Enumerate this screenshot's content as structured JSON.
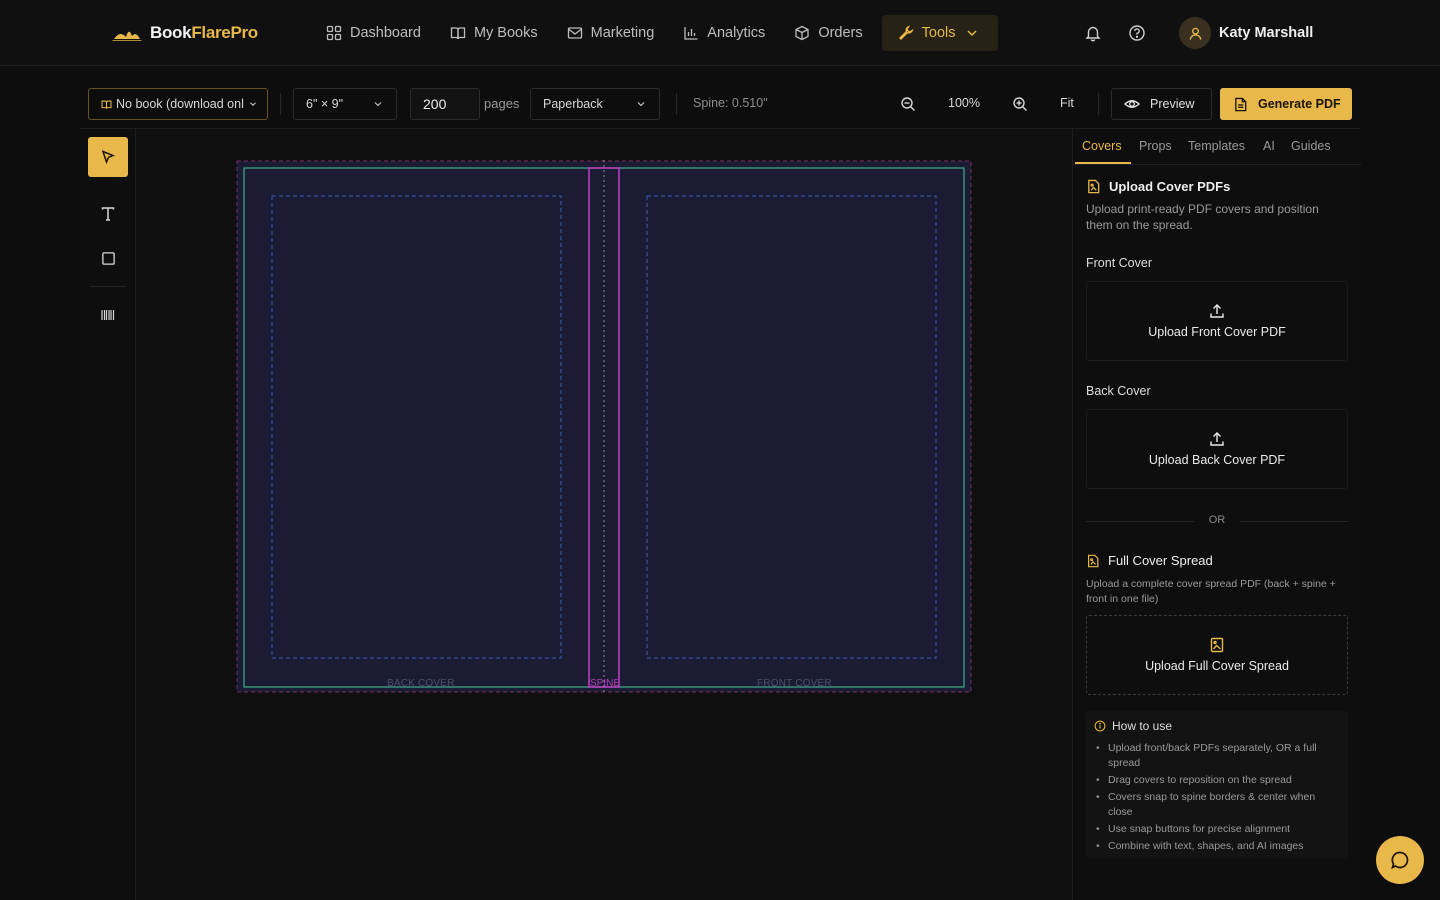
{
  "brand": {
    "name_part1": "Book",
    "name_part2": "FlarePro"
  },
  "nav": {
    "items": [
      {
        "label": "Dashboard",
        "icon": "grid-icon"
      },
      {
        "label": "My Books",
        "icon": "book-open-icon"
      },
      {
        "label": "Marketing",
        "icon": "mail-icon"
      },
      {
        "label": "Analytics",
        "icon": "bar-chart-icon"
      },
      {
        "label": "Orders",
        "icon": "box-icon"
      },
      {
        "label": "Tools",
        "icon": "wrench-icon"
      }
    ],
    "active": "Tools"
  },
  "user": {
    "name": "Katy Marshall"
  },
  "toolbar": {
    "book_select": "No book (download only)",
    "trim_size": "6\" × 9\"",
    "pages_value": "200",
    "pages_label": "pages",
    "binding": "Paperback",
    "spine": "Spine: 0.510\"",
    "zoom": "100%",
    "fit_label": "Fit",
    "preview_label": "Preview",
    "generate_label": "Generate PDF"
  },
  "canvas": {
    "back_label": "BACK COVER",
    "spine_label": "SPINE",
    "front_label": "FRONT COVER"
  },
  "panel": {
    "tabs": [
      "Covers",
      "Props",
      "Templates",
      "AI",
      "Guides"
    ],
    "active_tab": "Covers",
    "upload_title": "Upload Cover PDFs",
    "upload_desc": "Upload print-ready PDF covers and position them on the spread.",
    "front_label": "Front Cover",
    "front_button": "Upload Front Cover PDF",
    "back_label": "Back Cover",
    "back_button": "Upload Back Cover PDF",
    "or_text": "OR",
    "spread_title": "Full Cover Spread",
    "spread_desc": "Upload a complete cover spread PDF (back + spine + front in one file)",
    "spread_button": "Upload Full Cover Spread",
    "howto_title": "How to use",
    "howto_items": [
      "Upload front/back PDFs separately, OR a full spread",
      "Drag covers to reposition on the spread",
      "Covers snap to spine borders & center when close",
      "Use snap buttons for precise alignment",
      "Combine with text, shapes, and AI images"
    ]
  },
  "colors": {
    "accent": "#e8b84a",
    "spread_bg": "#1b1c33",
    "bleed": "#3fae87",
    "spine": "#c140c8",
    "safe": "#3a5ab8"
  }
}
